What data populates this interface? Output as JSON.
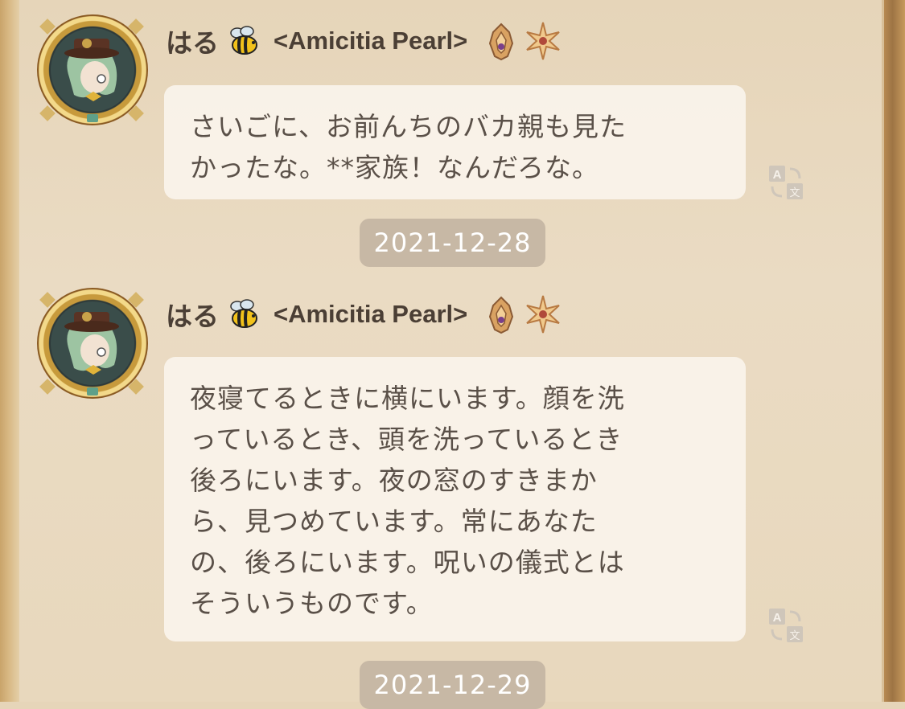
{
  "messages": [
    {
      "sender": "はる",
      "sender_emoji": "bee-emoji",
      "guild": "<Amicitia Pearl>",
      "text": "さいごに、お前んちのバカ親も見た\nかったな。**家族！なんだろな。"
    },
    {
      "sender": "はる",
      "sender_emoji": "bee-emoji",
      "guild": "<Amicitia Pearl>",
      "text": "夜寝てるときに横にいます。顔を洗\nっているとき、頭を洗っているとき\n後ろにいます。夜の窓のすきまか\nら、見つめています。常にあなた\nの、後ろにいます。呪いの儀式とは\nそういうものです。"
    }
  ],
  "dates": [
    "2021-12-28",
    "2021-12-29"
  ],
  "colors": {
    "background": "#e8d8bd",
    "bubble": "#faf4ec",
    "text": "#5a5048",
    "name": "#4b3f35",
    "date_chip": "#c7b8a5"
  }
}
